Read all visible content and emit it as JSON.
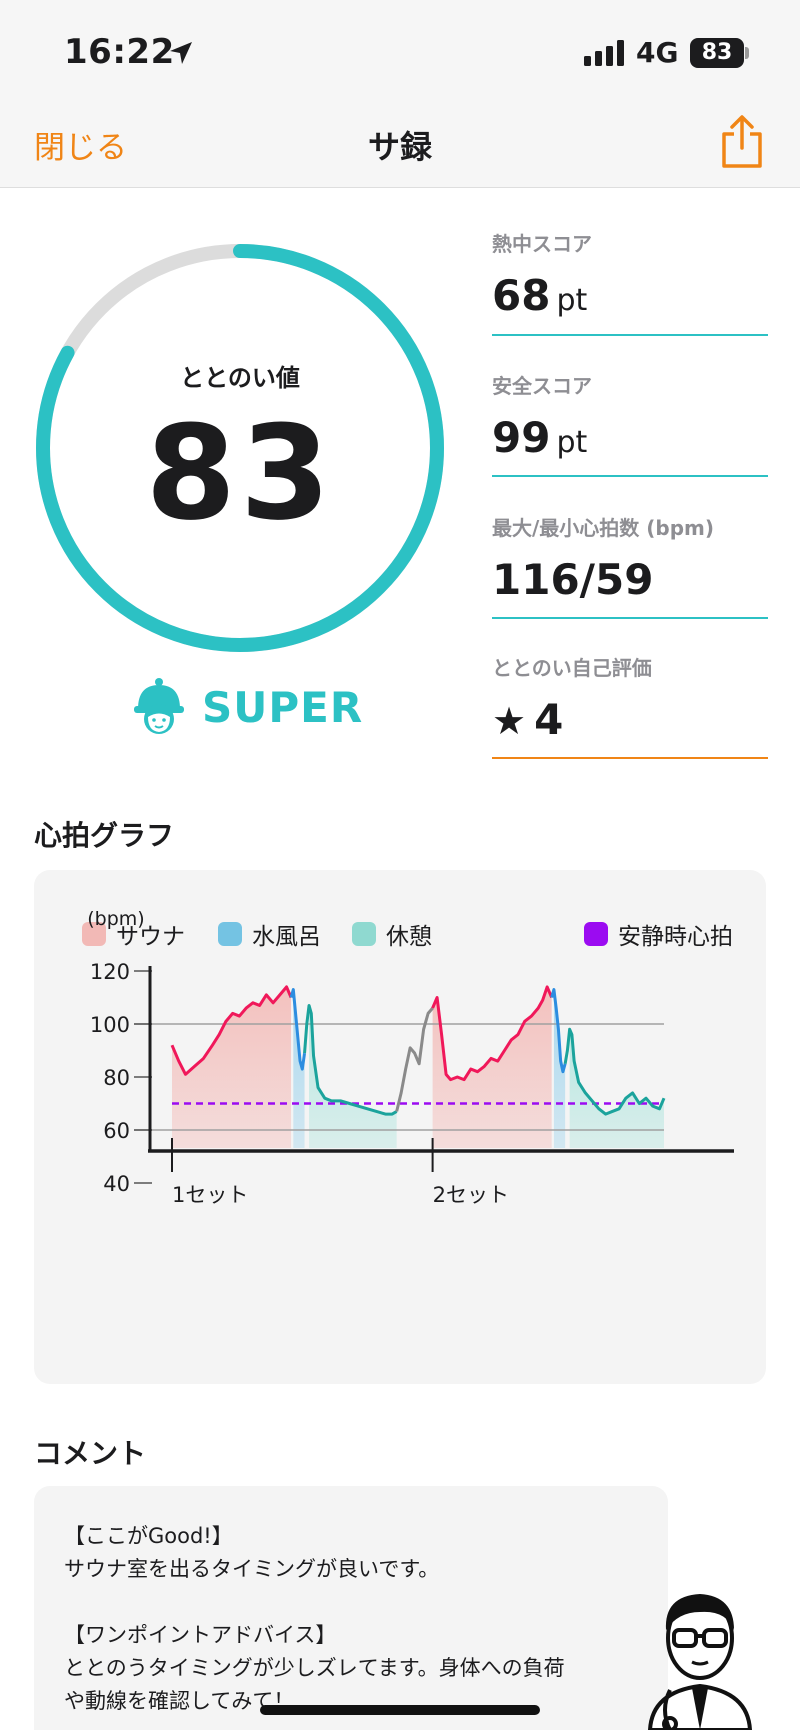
{
  "status_bar": {
    "time": "16:22",
    "network": "4G",
    "battery": "83"
  },
  "nav": {
    "close_label": "閉じる",
    "title": "サ録"
  },
  "score": {
    "label": "ととのい値",
    "value": "83",
    "progress": 0.83,
    "rank": "SUPER"
  },
  "stats": [
    {
      "label": "熱中スコア",
      "value": "68",
      "unit": "pt"
    },
    {
      "label": "安全スコア",
      "value": "99",
      "unit": "pt"
    },
    {
      "label": "最大/最小心拍数 (bpm)",
      "value": "116/59",
      "unit": ""
    },
    {
      "label": "ととのい自己評価",
      "value": "4",
      "unit": ""
    }
  ],
  "graph": {
    "title": "心拍グラフ",
    "legend": [
      {
        "label": "サウナ",
        "color": "#f2b9b6"
      },
      {
        "label": "水風呂",
        "color": "#74c3e3"
      },
      {
        "label": "休憩",
        "color": "#8fd9d0"
      },
      {
        "label": "安静時心拍",
        "color": "#9b0bf1"
      }
    ]
  },
  "chart_data": {
    "type": "line",
    "ylabel": "(bpm)",
    "yticks": [
      "120",
      "100",
      "80",
      "60",
      "40"
    ],
    "xticks": [
      "1セット",
      "2セット"
    ],
    "resting_hr": 70,
    "colors": {
      "sauna": "#f0185a",
      "cold": "#2c8de0",
      "rest": "#1ba39c",
      "transition": "#8a8a8a"
    },
    "series": [
      {
        "phase": "sauna",
        "x": [
          0,
          3,
          6,
          10,
          14,
          18,
          21,
          24,
          27,
          30,
          33,
          36,
          39,
          42,
          45,
          48,
          51,
          53
        ],
        "y": [
          92,
          86,
          81,
          84,
          87,
          92,
          96,
          101,
          104,
          103,
          106,
          108,
          107,
          111,
          108,
          111,
          114,
          110
        ]
      },
      {
        "phase": "cold",
        "x": [
          53,
          54,
          55,
          56,
          57,
          58,
          59
        ],
        "y": [
          110,
          113,
          104,
          95,
          86,
          83,
          89
        ]
      },
      {
        "phase": "rest",
        "x": [
          59,
          60,
          61,
          62,
          63,
          65,
          68,
          71,
          75,
          79,
          83,
          87,
          91,
          95,
          98,
          100
        ],
        "y": [
          89,
          100,
          107,
          104,
          88,
          76,
          72,
          71,
          71,
          70,
          69,
          68,
          67,
          66,
          66,
          67
        ]
      },
      {
        "phase": "transition",
        "x": [
          100,
          102,
          104,
          106,
          108,
          110,
          112,
          114,
          116
        ],
        "y": [
          67,
          74,
          83,
          91,
          89,
          85,
          98,
          104,
          106
        ]
      },
      {
        "phase": "sauna",
        "x": [
          116,
          118,
          120,
          122,
          124,
          127,
          130,
          133,
          136,
          139,
          142,
          145,
          148,
          151,
          154,
          157,
          160,
          163,
          165,
          167,
          169
        ],
        "y": [
          106,
          110,
          96,
          81,
          79,
          80,
          79,
          83,
          82,
          84,
          87,
          86,
          90,
          94,
          96,
          101,
          103,
          106,
          109,
          114,
          110
        ]
      },
      {
        "phase": "cold",
        "x": [
          169,
          170,
          171,
          172,
          173,
          174,
          175
        ],
        "y": [
          110,
          113,
          106,
          98,
          86,
          82,
          85
        ]
      },
      {
        "phase": "rest",
        "x": [
          175,
          176,
          177,
          178,
          179,
          181,
          184,
          187,
          190,
          193,
          196,
          199,
          202,
          205,
          208,
          211,
          214,
          217,
          219
        ],
        "y": [
          85,
          90,
          98,
          96,
          86,
          78,
          74,
          71,
          68,
          66,
          67,
          68,
          72,
          74,
          70,
          72,
          69,
          68,
          72
        ]
      }
    ],
    "fills": [
      {
        "phase": "sauna",
        "from": 0,
        "to": 53
      },
      {
        "phase": "cold",
        "from": 54,
        "to": 59
      },
      {
        "phase": "rest",
        "from": 61,
        "to": 100
      },
      {
        "phase": "sauna",
        "from": 116,
        "to": 169
      },
      {
        "phase": "cold",
        "from": 170,
        "to": 175
      },
      {
        "phase": "rest",
        "from": 177,
        "to": 219
      }
    ]
  },
  "comment": {
    "title": "コメント",
    "lines": [
      "【ここがGood!】",
      "サウナ室を出るタイミングが良いです。",
      "",
      "【ワンポイントアドバイス】",
      "ととのうタイミングが少しズレてます。身体への負荷",
      "や動線を確認してみて！"
    ]
  }
}
